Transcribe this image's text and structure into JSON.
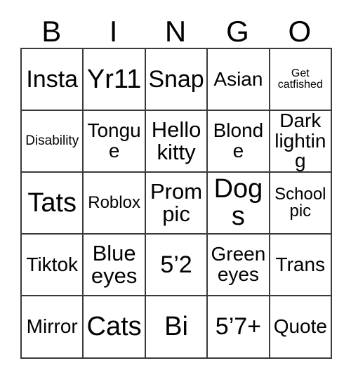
{
  "card": {
    "title": "BINGO",
    "header_letters": [
      "B",
      "I",
      "N",
      "G",
      "O"
    ],
    "colors": {
      "border": "#3a3a3a",
      "background": "#ffffff",
      "text": "#000000"
    },
    "rows": [
      [
        {
          "text": "Insta",
          "size": "fs-xl"
        },
        {
          "text": "Yr11",
          "size": "fs-xxl"
        },
        {
          "text": "Snap",
          "size": "fs-xl"
        },
        {
          "text": "Asian",
          "size": "fs-md"
        },
        {
          "text": "Get catfished",
          "size": "fs-xxs"
        }
      ],
      [
        {
          "text": "Disability",
          "size": "fs-xs"
        },
        {
          "text": "Tongue",
          "size": "fs-md"
        },
        {
          "text": "Hello kitty",
          "size": "fs-lg"
        },
        {
          "text": "Blonde",
          "size": "fs-md"
        },
        {
          "text": "Dark lighting",
          "size": "fs-md"
        }
      ],
      [
        {
          "text": "Tats",
          "size": "fs-xxl"
        },
        {
          "text": "Roblox",
          "size": "fs-sm"
        },
        {
          "text": "Prom pic",
          "size": "fs-lg"
        },
        {
          "text": "Dogs",
          "size": "fs-xxl"
        },
        {
          "text": "School pic",
          "size": "fs-sm"
        }
      ],
      [
        {
          "text": "Tiktok",
          "size": "fs-md"
        },
        {
          "text": "Blue eyes",
          "size": "fs-lg"
        },
        {
          "text": "5’2",
          "size": "fs-xl"
        },
        {
          "text": "Green eyes",
          "size": "fs-md"
        },
        {
          "text": "Trans",
          "size": "fs-md"
        }
      ],
      [
        {
          "text": "Mirror",
          "size": "fs-md"
        },
        {
          "text": "Cats",
          "size": "fs-xxl"
        },
        {
          "text": "Bi",
          "size": "fs-xxl"
        },
        {
          "text": "5’7+",
          "size": "fs-xl"
        },
        {
          "text": "Quote",
          "size": "fs-md"
        }
      ]
    ]
  }
}
